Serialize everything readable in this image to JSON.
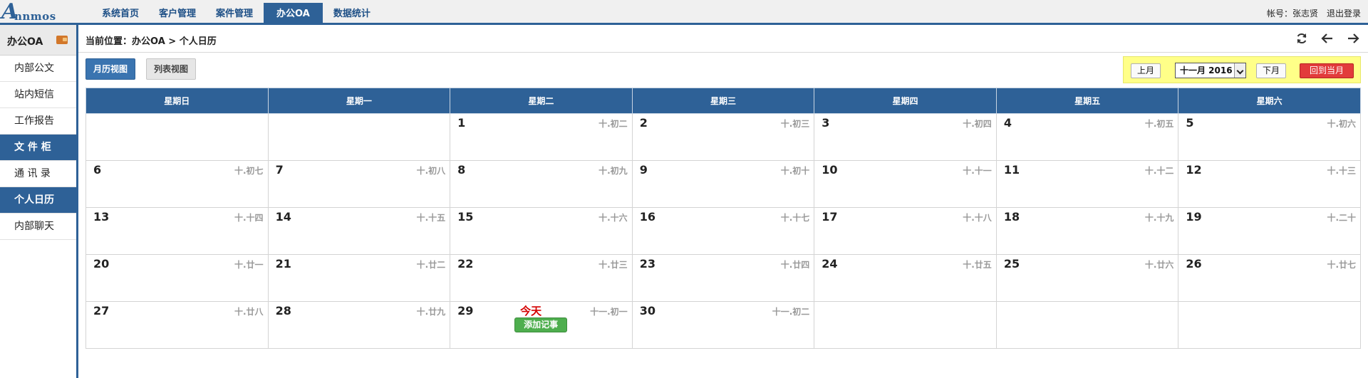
{
  "logo": {
    "big": "A",
    "rest": "nnmos"
  },
  "nav": {
    "items": [
      {
        "label": "系统首页"
      },
      {
        "label": "客户管理"
      },
      {
        "label": "案件管理"
      },
      {
        "label": "办公OA",
        "active": true
      },
      {
        "label": "数据统计"
      }
    ]
  },
  "account": {
    "user": "帐号：张志贤",
    "logout": "退出登录"
  },
  "sidebar": {
    "title": "办公OA",
    "items": [
      {
        "label": "内部公文"
      },
      {
        "label": "站内短信"
      },
      {
        "label": "工作报告"
      },
      {
        "label": "文 件 柜",
        "active": true
      },
      {
        "label": "通 讯 录"
      },
      {
        "label": "个人日历",
        "active": true
      },
      {
        "label": "内部聊天"
      }
    ]
  },
  "breadcrumb": "当前位置：办公OA > 个人日历",
  "views": {
    "month": "月历视图",
    "list": "列表视图"
  },
  "month_ctrl": {
    "prev": "上月",
    "selected": "十一月 2016",
    "next": "下月",
    "today": "回到当月"
  },
  "weekdays": [
    "星期日",
    "星期一",
    "星期二",
    "星期三",
    "星期四",
    "星期五",
    "星期六"
  ],
  "weeks": [
    [
      {
        "day": "",
        "lunar": ""
      },
      {
        "day": "",
        "lunar": ""
      },
      {
        "day": "1",
        "lunar": "十.初二"
      },
      {
        "day": "2",
        "lunar": "十.初三"
      },
      {
        "day": "3",
        "lunar": "十.初四"
      },
      {
        "day": "4",
        "lunar": "十.初五"
      },
      {
        "day": "5",
        "lunar": "十.初六"
      }
    ],
    [
      {
        "day": "6",
        "lunar": "十.初七"
      },
      {
        "day": "7",
        "lunar": "十.初八"
      },
      {
        "day": "8",
        "lunar": "十.初九"
      },
      {
        "day": "9",
        "lunar": "十.初十"
      },
      {
        "day": "10",
        "lunar": "十.十一"
      },
      {
        "day": "11",
        "lunar": "十.十二"
      },
      {
        "day": "12",
        "lunar": "十.十三"
      }
    ],
    [
      {
        "day": "13",
        "lunar": "十.十四"
      },
      {
        "day": "14",
        "lunar": "十.十五"
      },
      {
        "day": "15",
        "lunar": "十.十六"
      },
      {
        "day": "16",
        "lunar": "十.十七"
      },
      {
        "day": "17",
        "lunar": "十.十八"
      },
      {
        "day": "18",
        "lunar": "十.十九"
      },
      {
        "day": "19",
        "lunar": "十.二十"
      }
    ],
    [
      {
        "day": "20",
        "lunar": "十.廿一"
      },
      {
        "day": "21",
        "lunar": "十.廿二"
      },
      {
        "day": "22",
        "lunar": "十.廿三"
      },
      {
        "day": "23",
        "lunar": "十.廿四"
      },
      {
        "day": "24",
        "lunar": "十.廿五"
      },
      {
        "day": "25",
        "lunar": "十.廿六"
      },
      {
        "day": "26",
        "lunar": "十.廿七"
      }
    ],
    [
      {
        "day": "27",
        "lunar": "十.廿八"
      },
      {
        "day": "28",
        "lunar": "十.廿九"
      },
      {
        "day": "29",
        "lunar": "十一.初一",
        "today": "今天",
        "add": "添加记事"
      },
      {
        "day": "30",
        "lunar": "十一.初二"
      },
      {
        "day": "",
        "lunar": ""
      },
      {
        "day": "",
        "lunar": ""
      },
      {
        "day": "",
        "lunar": ""
      }
    ]
  ],
  "icons": {
    "refresh": "refresh-icon",
    "back": "arrow-left-icon",
    "forward": "arrow-right-icon",
    "wallet": "wallet-icon"
  },
  "colors": {
    "primary": "#2e6197",
    "today": "#d40000",
    "highlight": "#ffff88",
    "add": "#4eae4e"
  }
}
